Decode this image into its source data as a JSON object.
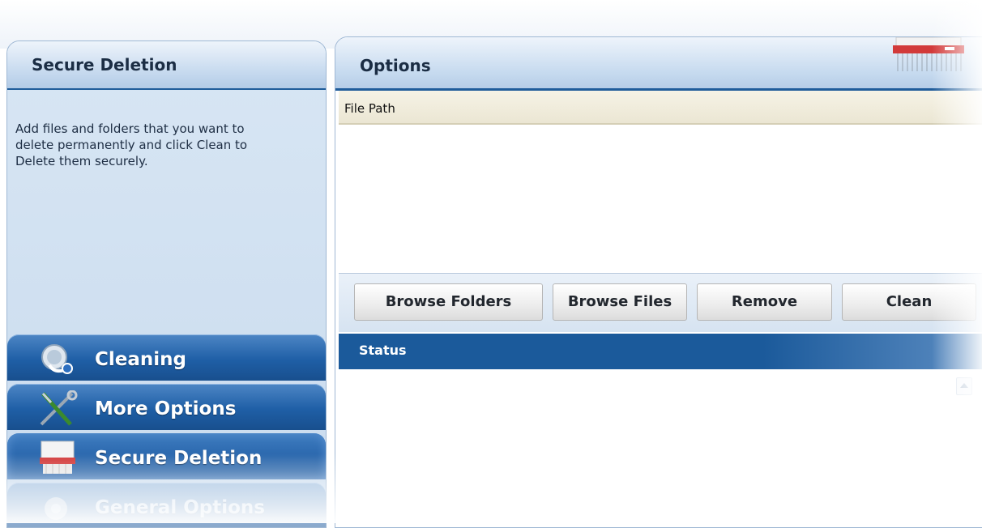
{
  "left_panel": {
    "title": "Secure Deletion",
    "description": "Add files and folders that you want to delete permanently and click Clean to Delete them securely."
  },
  "nav": {
    "items": [
      {
        "label": "Cleaning",
        "icon": "cleaning-icon"
      },
      {
        "label": "More Options",
        "icon": "tools-icon"
      },
      {
        "label": "Secure Deletion",
        "icon": "shredder-icon",
        "active": true
      },
      {
        "label": "General Options",
        "icon": "gear-icon"
      }
    ]
  },
  "options": {
    "title": "Options",
    "list_column": "File Path"
  },
  "buttons": {
    "browse_folders": "Browse Folders",
    "browse_files": "Browse Files",
    "remove": "Remove",
    "clean": "Clean"
  },
  "status": {
    "title": "Status"
  },
  "colors": {
    "nav_blue": "#1f5fa6",
    "header_line": "#1f5c9a",
    "status_blue": "#1b5a9b",
    "shredder_red": "#d23a3a"
  }
}
